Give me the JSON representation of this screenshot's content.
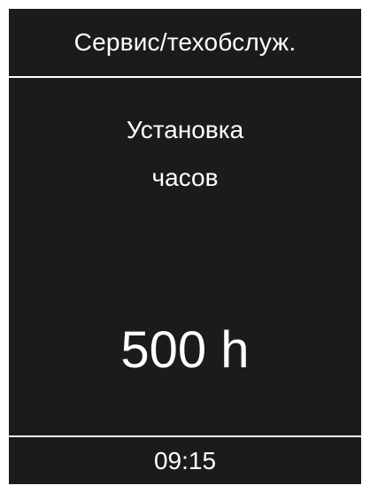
{
  "header": {
    "title": "Сервис/техобслуж."
  },
  "main": {
    "label_line1": "Установка",
    "label_line2": "часов",
    "value": "500 h"
  },
  "footer": {
    "time": "09:15"
  },
  "colors": {
    "background": "#1c1b1a",
    "foreground": "#ffffff"
  }
}
